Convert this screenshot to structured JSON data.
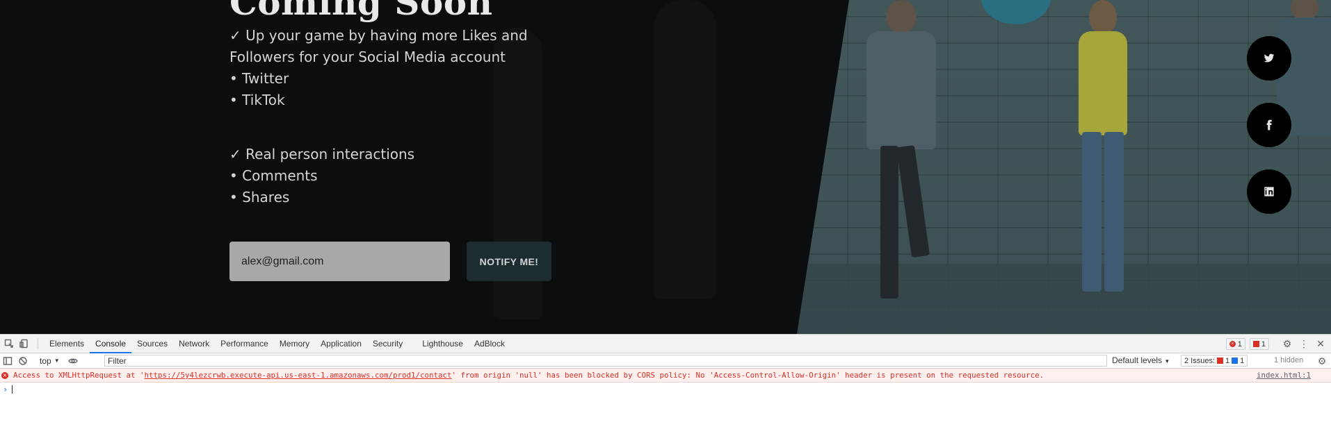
{
  "landing": {
    "headline": "Coming Soon",
    "block1": [
      "✓ Up your game by having more Likes and",
      "Followers for your Social Media account",
      "• Twitter",
      "• TikTok"
    ],
    "block2": [
      "✓ Real person interactions",
      "• Comments",
      "• Shares"
    ],
    "email_value": "alex@gmail.com",
    "notify_label": "NOTIFY ME!",
    "social": [
      {
        "icon": "twitter-icon"
      },
      {
        "icon": "facebook-icon"
      },
      {
        "icon": "linkedin-icon"
      }
    ]
  },
  "devtools": {
    "tabs": [
      "Elements",
      "Console",
      "Sources",
      "Network",
      "Performance",
      "Memory",
      "Application",
      "Security",
      "Lighthouse",
      "AdBlock"
    ],
    "active_tab": "Console",
    "error_count": "1",
    "warning_count": "1",
    "context": "top",
    "filter_placeholder": "Filter",
    "levels": "Default levels",
    "issues_label": "2 Issues:",
    "issues_error": "1",
    "issues_info": "1",
    "hidden_label": "1 hidden",
    "error": {
      "prefix": "Access to XMLHttpRequest at '",
      "url": "https://5y4lezcrwb.execute-api.us-east-1.amazonaws.com/prod1/contact",
      "suffix": "' from origin 'null' has been blocked by CORS policy: No 'Access-Control-Allow-Origin' header is present on the requested resource.",
      "source": "index.html:1"
    },
    "prompt_symbol": "›"
  },
  "colors": {
    "accent": "#1a73e8",
    "error": "#d93025",
    "notify_bg": "#1d2d2f"
  }
}
